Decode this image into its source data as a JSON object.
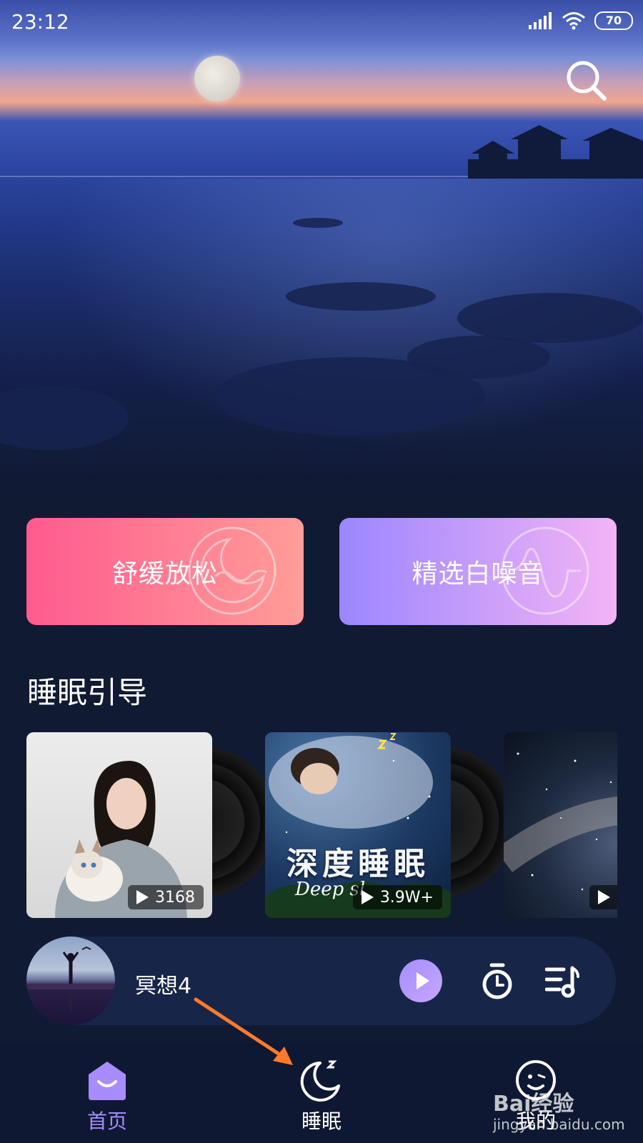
{
  "status_bar": {
    "time": "23:12",
    "battery": "70"
  },
  "cards": {
    "relax": "舒缓放松",
    "white_noise": "精选白噪音"
  },
  "section": {
    "title": "睡眠引导"
  },
  "albums": [
    {
      "play_count": "3168"
    },
    {
      "cover_title": "深度睡眠",
      "cover_subtitle": "Deep sl",
      "play_count": "3.9W+"
    },
    {
      "play_count": ""
    }
  ],
  "player": {
    "track": "冥想4"
  },
  "nav": {
    "home": "首页",
    "sleep": "睡眠",
    "mine": "我的"
  },
  "watermark": {
    "brand": "Bai经验",
    "url": "jingyan.baidu.com"
  },
  "colors": {
    "accent": "#a68cff",
    "card_relax": [
      "#ff5b8e",
      "#ff9d98"
    ],
    "card_noise": [
      "#9b86ff",
      "#f3b4f5"
    ],
    "annotation_arrow": "#ff7a2b",
    "background": "#111a33"
  }
}
